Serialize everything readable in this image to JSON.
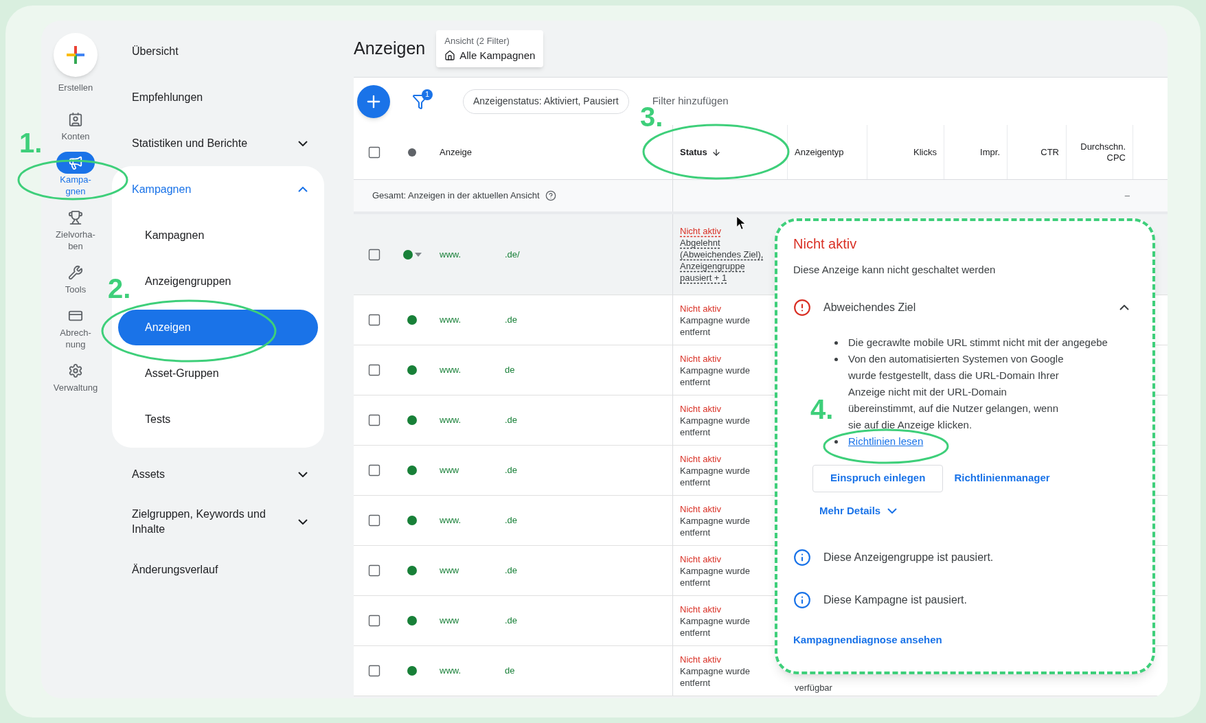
{
  "rail": {
    "create": {
      "label": "Erstellen"
    },
    "items": [
      {
        "lines": [
          "Konten"
        ],
        "selected": false
      },
      {
        "lines": [
          "Kampa-",
          "gnen"
        ],
        "selected": true
      },
      {
        "lines": [
          "Zielvorha-",
          "ben"
        ],
        "selected": false
      },
      {
        "lines": [
          "Tools"
        ],
        "selected": false
      },
      {
        "lines": [
          "Abrech-",
          "nung"
        ],
        "selected": false
      },
      {
        "lines": [
          "Verwaltung"
        ],
        "selected": false
      }
    ]
  },
  "nav": {
    "items": [
      {
        "label": "Übersicht"
      },
      {
        "label": "Empfehlungen"
      },
      {
        "label": "Statistiken und Berichte",
        "expanded": false
      },
      {
        "label": "Kampagnen",
        "expanded": true,
        "children": [
          {
            "label": "Kampagnen",
            "selected": false
          },
          {
            "label": "Anzeigengruppen",
            "selected": false
          },
          {
            "label": "Anzeigen",
            "selected": true
          },
          {
            "label": "Asset-Gruppen",
            "selected": false
          },
          {
            "label": "Tests",
            "selected": false
          }
        ]
      },
      {
        "label": "Assets",
        "expanded": false
      },
      {
        "label": "Zielgruppen, Keywords und Inhalte",
        "expanded": false
      },
      {
        "label": "Änderungsverlauf"
      }
    ]
  },
  "page": {
    "title": "Anzeigen",
    "view": {
      "caption": "Ansicht (2 Filter)",
      "value": "Alle Kampagnen"
    }
  },
  "toolbar": {
    "filter_badge": "1",
    "filter_chip": "Anzeigenstatus: Aktiviert, Pausiert",
    "add_filter": "Filter hinzufügen"
  },
  "table": {
    "select_all": {
      "checked": false
    },
    "columns": [
      {
        "label": "Anzeige",
        "sorted": false
      },
      {
        "label": "Status",
        "sorted": true
      },
      {
        "label": "Anzeigentyp",
        "sorted": false
      },
      {
        "label": "Klicks",
        "sorted": false
      },
      {
        "label": "Impr.",
        "sorted": false
      },
      {
        "label": "CTR",
        "sorted": false
      },
      {
        "label": "Durchschn. CPC",
        "sorted": false
      }
    ],
    "summary": {
      "label": "Gesamt: Anzeigen in der aktuellen Ansicht",
      "cpc": "–"
    },
    "rows": [
      {
        "checked": false,
        "highlighted": true,
        "url_start": "www.",
        "url_end": ".de/",
        "status": "Nicht aktiv",
        "detail": "Abgelehnt (Abweichendes Ziel), Anzeigengruppe pausiert + 1"
      },
      {
        "checked": false,
        "highlighted": false,
        "url_start": "www.",
        "url_end": ".de",
        "status": "Nicht aktiv",
        "detail": "Kampagne wurde entfernt"
      },
      {
        "checked": false,
        "highlighted": false,
        "url_start": "www.",
        "url_end": "de",
        "status": "Nicht aktiv",
        "detail": "Kampagne wurde entfernt"
      },
      {
        "checked": false,
        "highlighted": false,
        "url_start": "www.",
        "url_end": ".de",
        "status": "Nicht aktiv",
        "detail": "Kampagne wurde entfernt"
      },
      {
        "checked": false,
        "highlighted": false,
        "url_start": "www",
        "url_end": ".de",
        "status": "Nicht aktiv",
        "detail": "Kampagne wurde entfernt"
      },
      {
        "checked": false,
        "highlighted": false,
        "url_start": "www.",
        "url_end": ".de",
        "status": "Nicht aktiv",
        "detail": "Kampagne wurde entfernt"
      },
      {
        "checked": false,
        "highlighted": false,
        "url_start": "www",
        "url_end": ".de",
        "status": "Nicht aktiv",
        "detail": "Kampagne wurde entfernt"
      },
      {
        "checked": false,
        "highlighted": false,
        "url_start": "www",
        "url_end": ".de",
        "status": "Nicht aktiv",
        "detail": "Kampagne wurde entfernt"
      },
      {
        "checked": false,
        "highlighted": false,
        "url_start": "www.",
        "url_end": "de",
        "status": "Nicht aktiv",
        "detail": "Kampagne wurde entfernt",
        "ad_type": "verfügbar"
      }
    ]
  },
  "popup": {
    "title": "Nicht aktiv",
    "subtitle": "Diese Anzeige kann nicht geschaltet werden",
    "issue": {
      "title": "Abweichendes Ziel",
      "expanded": true,
      "bullets": [
        "Die gecrawlte mobile URL stimmt nicht mit der angegebe",
        "Von den automatisierten Systemen von Google wurde festgestellt, dass die URL-Domain Ihrer Anzeige nicht mit der URL-Domain übereinstimmt, auf die Nutzer gelangen, wenn sie auf die Anzeige klicken."
      ],
      "link": "Richtlinien lesen",
      "appeal_button": "Einspruch einlegen",
      "manager_link": "Richtlinienmanager",
      "more_details": "Mehr Details"
    },
    "notes": [
      "Diese Anzeigengruppe ist pausiert.",
      "Diese Kampagne ist pausiert."
    ],
    "footer_link": "Kampagnendiagnose ansehen"
  },
  "annotations": [
    {
      "label": "1."
    },
    {
      "label": "2."
    },
    {
      "label": "3."
    },
    {
      "label": "4."
    }
  ]
}
